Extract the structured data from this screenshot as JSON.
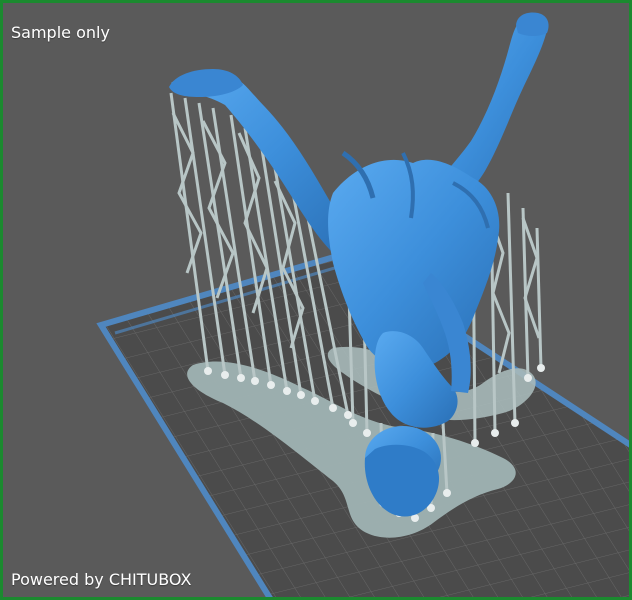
{
  "viewport": {
    "watermark_top": "Sample only",
    "watermark_bottom": "Powered by CHITUBOX"
  },
  "colors": {
    "frame": "#1b8a2f",
    "background": "#5a5a5a",
    "build_plate": "#4a4a4a",
    "plate_border": "#4f86be",
    "grid_line": "#6a6a6a",
    "raft": "#9fb3b3",
    "supports": "#b8c6c6",
    "model": "#3d8fdb",
    "model_shadow": "#2f6fb0"
  },
  "icons": {
    "build_plate": "build-plate-icon",
    "model": "3d-model-icon",
    "supports": "support-structure-icon"
  }
}
